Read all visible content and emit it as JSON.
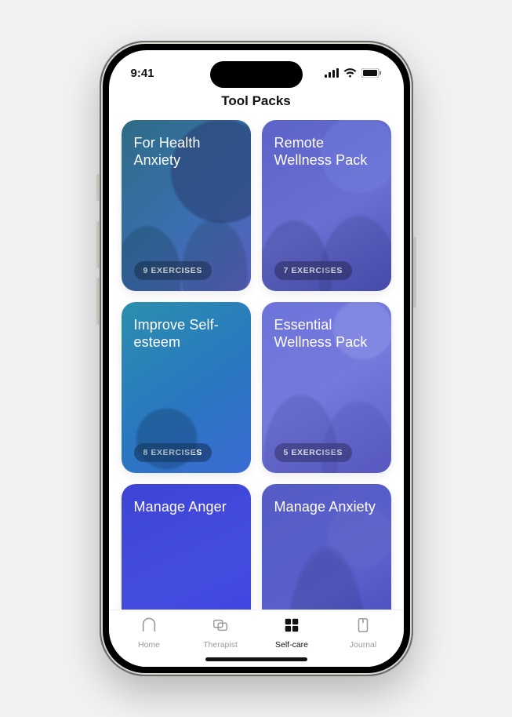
{
  "status": {
    "time": "9:41"
  },
  "header": {
    "title": "Tool Packs"
  },
  "packs": [
    {
      "title": "For Health Anxiety",
      "badge": "9 EXERCISES",
      "bg": "bg-teal-violet"
    },
    {
      "title": "Remote Wellness Pack",
      "badge": "7 EXERCISES",
      "bg": "bg-violet-indigo"
    },
    {
      "title": "Improve Self-esteem",
      "badge": "8 EXERCISES",
      "bg": "bg-cyan-blue"
    },
    {
      "title": "Essential Wellness Pack",
      "badge": "5 EXERCISES",
      "bg": "bg-periwinkle"
    },
    {
      "title": "Manage Anger",
      "badge": "",
      "bg": "bg-royal"
    },
    {
      "title": "Manage Anxiety",
      "badge": "",
      "bg": "bg-slate-violet"
    }
  ],
  "tabs": [
    {
      "label": "Home",
      "active": false
    },
    {
      "label": "Therapist",
      "active": false
    },
    {
      "label": "Self-care",
      "active": true
    },
    {
      "label": "Journal",
      "active": false
    }
  ]
}
